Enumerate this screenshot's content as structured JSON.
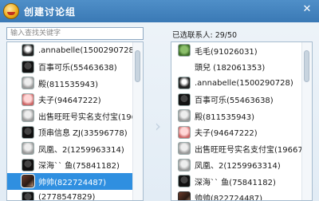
{
  "window": {
    "title": "创建讨论组",
    "close_glyph": "✕"
  },
  "search": {
    "placeholder": "输入查找关键字",
    "value": ""
  },
  "selected": {
    "count_label": "已选联系人: 29/50"
  },
  "left_list": [
    {
      "label": ".annabelle(1500290728)",
      "avatar": "bw"
    },
    {
      "label": "百事可乐(55463638)",
      "avatar": "dark"
    },
    {
      "label": "殿(811535943)",
      "avatar": "gray"
    },
    {
      "label": "夫子(94647222)",
      "avatar": "pink"
    },
    {
      "label": "出售旺旺号实名支付宝(196",
      "avatar": "gray"
    },
    {
      "label": "顶串信息 ZJ(33596778)",
      "avatar": "dark"
    },
    {
      "label": "凤凰、2(1259963314)",
      "avatar": "gray"
    },
    {
      "label": "深海`` 鱼(75841182)",
      "avatar": "dark"
    },
    {
      "label": "帅帅(822724487)",
      "avatar": "photo",
      "selected": true
    },
    {
      "label": "(2778547829)",
      "avatar": "dark"
    }
  ],
  "right_list": [
    {
      "label": "毛毛(91026031)",
      "avatar": "green"
    },
    {
      "label": "頭兒 (182061353)",
      "avatar": "empty"
    },
    {
      "label": ".annabelle(1500290728)",
      "avatar": "bw"
    },
    {
      "label": "百事可乐(55463638)",
      "avatar": "dark"
    },
    {
      "label": "殿(811535943)",
      "avatar": "gray"
    },
    {
      "label": "夫子(94647222)",
      "avatar": "pink"
    },
    {
      "label": "出售旺旺号实名支付宝(19667",
      "avatar": "gray"
    },
    {
      "label": "凤凰、2(1259963314)",
      "avatar": "gray"
    },
    {
      "label": "深海`` 鱼(75841182)",
      "avatar": "dark"
    },
    {
      "label": "帅帅(822724487)",
      "avatar": "photo"
    }
  ],
  "transfer_arrow": "›"
}
